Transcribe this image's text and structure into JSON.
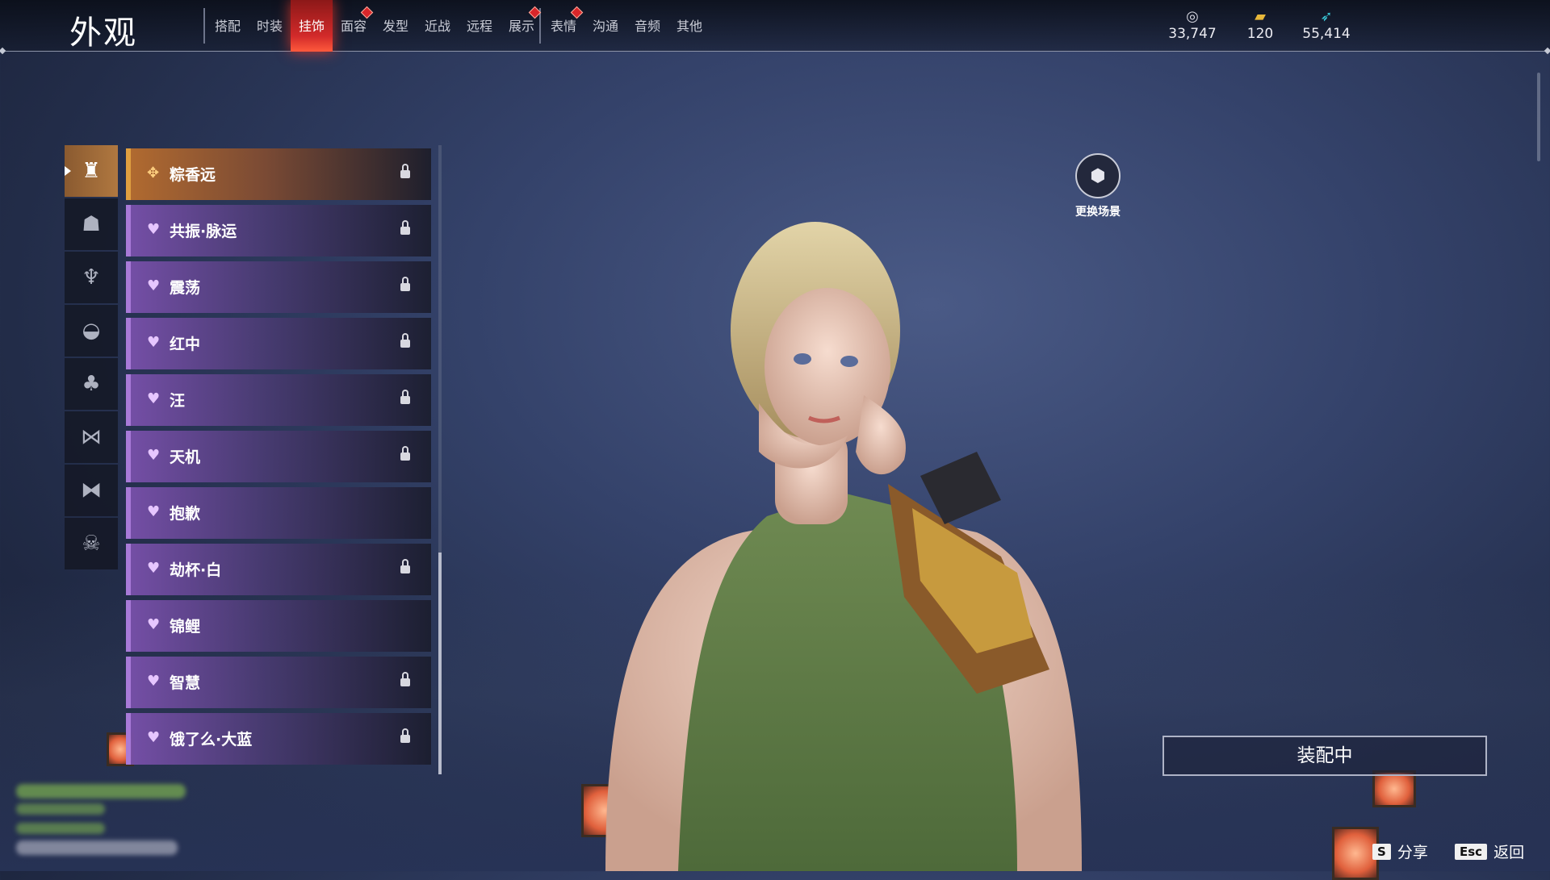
{
  "header": {
    "title": "外观",
    "tabs": [
      {
        "label": "搭配",
        "active": false,
        "badge": false
      },
      {
        "label": "时装",
        "active": false,
        "badge": false
      },
      {
        "label": "挂饰",
        "active": true,
        "badge": false
      },
      {
        "label": "面容",
        "active": false,
        "badge": true
      },
      {
        "label": "发型",
        "active": false,
        "badge": false
      },
      {
        "label": "近战",
        "active": false,
        "badge": false
      },
      {
        "label": "远程",
        "active": false,
        "badge": false
      },
      {
        "label": "展示",
        "active": false,
        "badge": true
      },
      {
        "label": "表情",
        "active": false,
        "badge": true
      },
      {
        "label": "沟通",
        "active": false,
        "badge": false
      },
      {
        "label": "音频",
        "active": false,
        "badge": false
      },
      {
        "label": "其他",
        "active": false,
        "badge": false
      }
    ],
    "currencies": [
      {
        "icon": "coin-stack-icon",
        "value": "33,747"
      },
      {
        "icon": "ticket-icon",
        "value": "120"
      },
      {
        "icon": "feather-icon",
        "value": "55,414"
      }
    ]
  },
  "categories": [
    {
      "icon": "helmet-icon",
      "active": true
    },
    {
      "icon": "hat-icon",
      "active": false
    },
    {
      "icon": "hairpin-icon",
      "active": false
    },
    {
      "icon": "mask-icon",
      "active": false
    },
    {
      "icon": "cape-icon",
      "active": false
    },
    {
      "icon": "waist-icon",
      "active": false
    },
    {
      "icon": "back-ornament-icon",
      "active": false
    },
    {
      "icon": "demon-face-icon",
      "active": false
    }
  ],
  "list": {
    "items": [
      {
        "label": "粽香远",
        "locked": true,
        "selected": true
      },
      {
        "label": "共振·脉运",
        "locked": true,
        "selected": false
      },
      {
        "label": "震荡",
        "locked": true,
        "selected": false
      },
      {
        "label": "红中",
        "locked": true,
        "selected": false
      },
      {
        "label": "汪",
        "locked": true,
        "selected": false
      },
      {
        "label": "天机",
        "locked": true,
        "selected": false
      },
      {
        "label": "抱歉",
        "locked": false,
        "selected": false
      },
      {
        "label": "劫杯·白",
        "locked": true,
        "selected": false
      },
      {
        "label": "锦鲤",
        "locked": false,
        "selected": false
      },
      {
        "label": "智慧",
        "locked": true,
        "selected": false
      },
      {
        "label": "饿了么·大蓝",
        "locked": true,
        "selected": false
      }
    ]
  },
  "scene": {
    "label": "更换场景",
    "icon": "cube-icon"
  },
  "equip_button": "装配中",
  "hints": [
    {
      "key": "S",
      "label": "分享"
    },
    {
      "key": "Esc",
      "label": "返回"
    }
  ],
  "colors": {
    "accent_red": "#d22a2a",
    "selected_orange": "#b06a30",
    "rarity_purple": "#a87ad8"
  }
}
